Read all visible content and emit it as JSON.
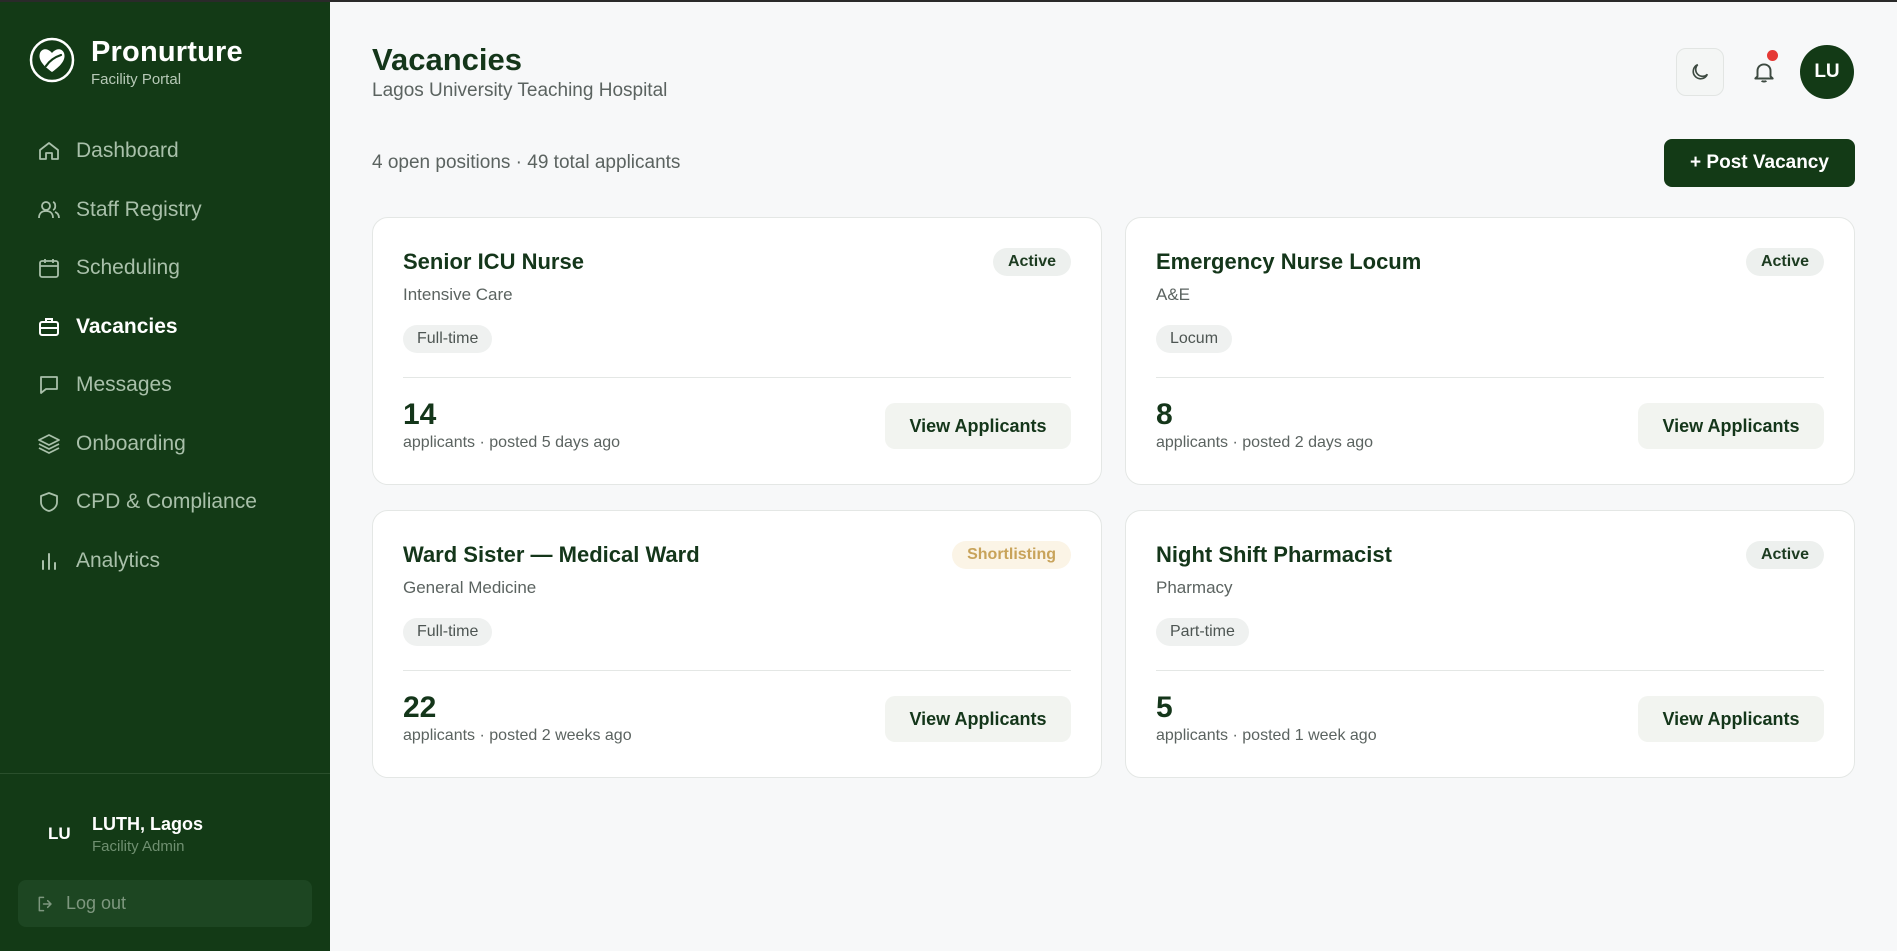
{
  "sidebar": {
    "brand": {
      "name": "Pronurture",
      "subtitle": "Facility Portal"
    },
    "items": [
      {
        "label": "Dashboard",
        "icon": "home-icon",
        "active": false
      },
      {
        "label": "Staff Registry",
        "icon": "users-icon",
        "active": false
      },
      {
        "label": "Scheduling",
        "icon": "calendar-icon",
        "active": false
      },
      {
        "label": "Vacancies",
        "icon": "briefcase-icon",
        "active": true
      },
      {
        "label": "Messages",
        "icon": "message-icon",
        "active": false
      },
      {
        "label": "Onboarding",
        "icon": "layers-icon",
        "active": false
      },
      {
        "label": "CPD & Compliance",
        "icon": "shield-icon",
        "active": false
      },
      {
        "label": "Analytics",
        "icon": "bar-chart-icon",
        "active": false
      }
    ],
    "user": {
      "initials": "LU",
      "name": "LUTH, Lagos",
      "role": "Facility Admin"
    },
    "logout_label": "Log out"
  },
  "header": {
    "title": "Vacancies",
    "subtitle": "Lagos University Teaching Hospital",
    "avatar_initials": "LU"
  },
  "summary": "4 open positions · 49 total applicants",
  "post_button_label": "+ Post Vacancy",
  "view_button_label": "View Applicants",
  "colors": {
    "sidebar_bg": "#133a16",
    "accent": "#133a16",
    "shortlisting": "#c8a35a",
    "notification": "#e53935"
  },
  "vacancies": [
    {
      "title": "Senior ICU Nurse",
      "department": "Intensive Care",
      "type": "Full-time",
      "status": "Active",
      "applicants": "14",
      "meta": "applicants · posted 5 days ago"
    },
    {
      "title": "Emergency Nurse Locum",
      "department": "A&E",
      "type": "Locum",
      "status": "Active",
      "applicants": "8",
      "meta": "applicants · posted 2 days ago"
    },
    {
      "title": "Ward Sister — Medical Ward",
      "department": "General Medicine",
      "type": "Full-time",
      "status": "Shortlisting",
      "applicants": "22",
      "meta": "applicants · posted 2 weeks ago"
    },
    {
      "title": "Night Shift Pharmacist",
      "department": "Pharmacy",
      "type": "Part-time",
      "status": "Active",
      "applicants": "5",
      "meta": "applicants · posted 1 week ago"
    }
  ]
}
